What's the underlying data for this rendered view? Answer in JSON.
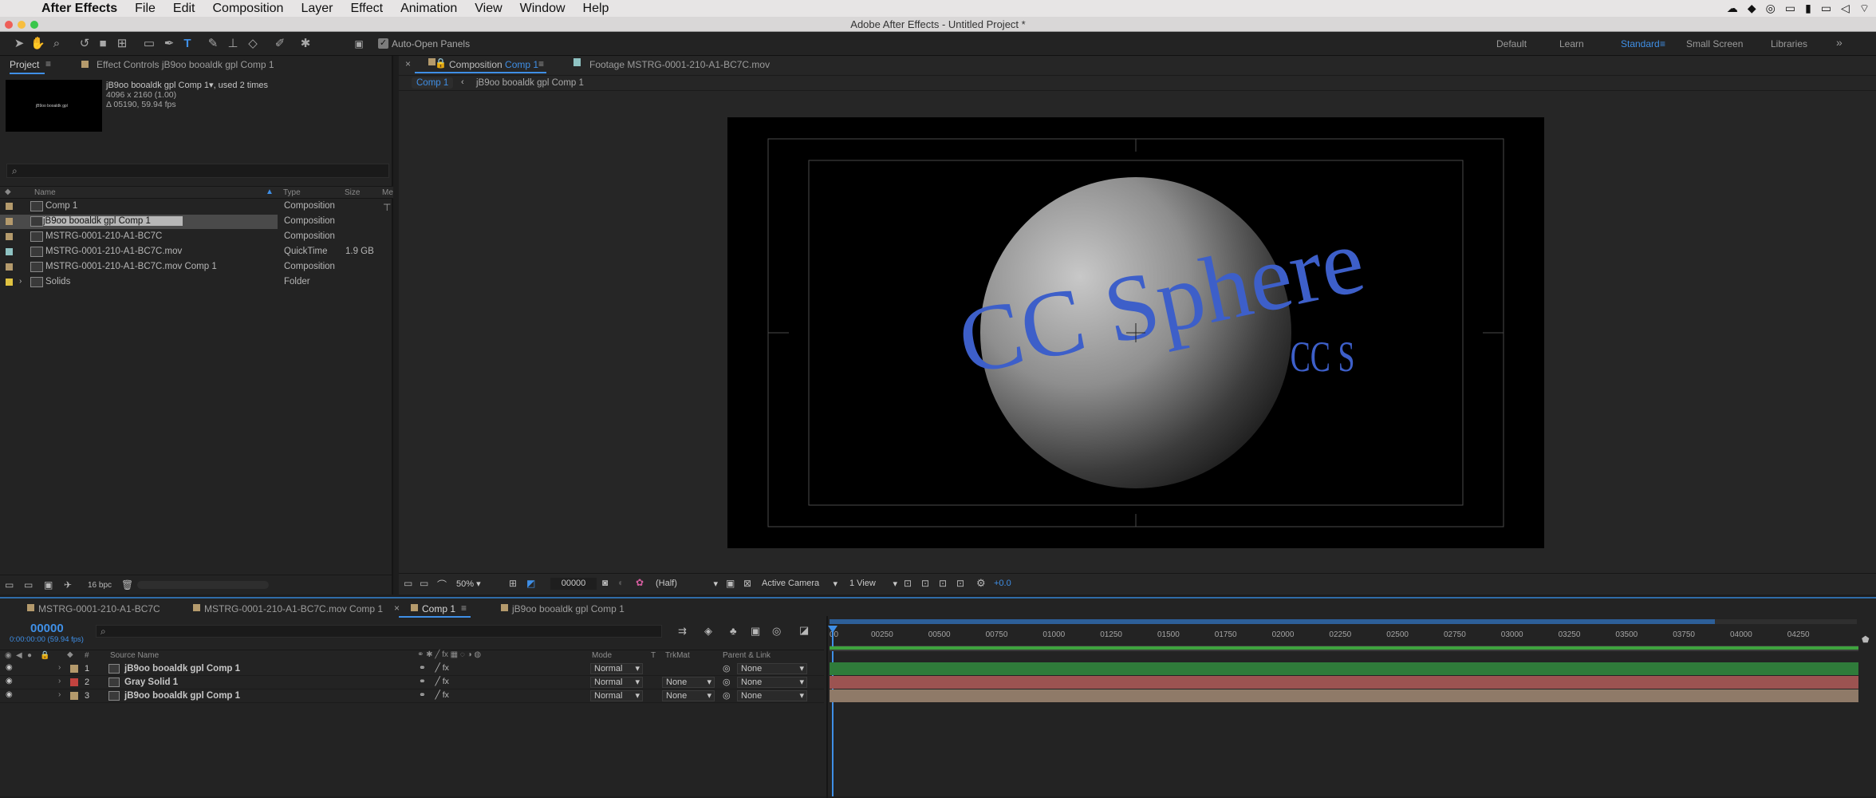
{
  "menubar": {
    "app": "After Effects",
    "items": [
      "File",
      "Edit",
      "Composition",
      "Layer",
      "Effect",
      "Animation",
      "View",
      "Window",
      "Help"
    ]
  },
  "window": {
    "title": "Adobe After Effects - Untitled Project *"
  },
  "toolbar": {
    "auto_open_label": "Auto-Open Panels",
    "workspaces": [
      "Default",
      "Learn",
      "Standard",
      "Small Screen",
      "Libraries"
    ],
    "active_workspace": "Standard"
  },
  "project": {
    "tab_project": "Project",
    "tab_effects": "Effect Controls jB9oo booaldk gpl  Comp 1",
    "selected_name": "jB9oo booaldk gpl  Comp 1",
    "used_times": ", used 2 times",
    "selected_dims": "4096 x 2160 (1.00)",
    "selected_dur": "Δ 05190, 59.94 fps",
    "thumb_text": "jB9oo booaldk gpl",
    "search_placeholder": "",
    "columns": {
      "name": "Name",
      "type": "Type",
      "size": "Size",
      "media": "Me"
    },
    "items": [
      {
        "name": "Comp 1",
        "type": "Composition",
        "size": "",
        "color": "#b49a6c"
      },
      {
        "name": "jB9oo booaldk gpl  Comp 1",
        "type": "Composition",
        "size": "",
        "color": "#b49a6c"
      },
      {
        "name": "MSTRG-0001-210-A1-BC7C",
        "type": "Composition",
        "size": "",
        "color": "#b49a6c"
      },
      {
        "name": "MSTRG-0001-210-A1-BC7C.mov",
        "type": "QuickTime",
        "size": "1.9 GB",
        "color": "#8fc3c3"
      },
      {
        "name": "MSTRG-0001-210-A1-BC7C.mov Comp 1",
        "type": "Composition",
        "size": "",
        "color": "#b49a6c"
      },
      {
        "name": "Solids",
        "type": "Folder",
        "size": "",
        "color": "#e0c341"
      }
    ],
    "bpc": "16 bpc"
  },
  "viewer": {
    "tab_comp_prefix": "Composition ",
    "tab_comp_name": "Comp 1",
    "tab_footage": "Footage MSTRG-0001-210-A1-BC7C.mov",
    "crumb_active": "Comp 1",
    "crumb_next": "jB9oo booaldk gpl  Comp 1",
    "text_main": "CC Sphere",
    "text_side": "CC S",
    "zoom": "50%",
    "timecode": "00000",
    "resolution": "(Half)",
    "camera": "Active Camera",
    "views": "1 View",
    "exposure": "+0.0"
  },
  "timeline": {
    "tabs": [
      "MSTRG-0001-210-A1-BC7C",
      "MSTRG-0001-210-A1-BC7C.mov Comp 1",
      "Comp 1",
      "jB9oo booaldk gpl  Comp 1"
    ],
    "active_tab": "Comp 1",
    "timecode": "00000",
    "timecode_sub": "0:00:00:00 (59.94 fps)",
    "columns": {
      "num": "#",
      "source": "Source Name",
      "mode": "Mode",
      "t": "T",
      "trkmat": "TrkMat",
      "parent": "Parent & Link"
    },
    "layers": [
      {
        "num": "1",
        "name": "jB9oo booaldk gpl  Comp 1",
        "color": "#b49a6c",
        "mode": "Normal",
        "trkmat": "",
        "parent": "None",
        "bar": "#2f7b3a"
      },
      {
        "num": "2",
        "name": "Gray Solid 1",
        "color": "#c2433f",
        "mode": "Normal",
        "trkmat": "None",
        "parent": "None",
        "bar": "#9c5351"
      },
      {
        "num": "3",
        "name": "jB9oo booaldk gpl  Comp 1",
        "color": "#b49a6c",
        "mode": "Normal",
        "trkmat": "None",
        "parent": "None",
        "bar": "#8f7a68"
      }
    ],
    "ruler": [
      "00250",
      "00500",
      "00750",
      "01000",
      "01250",
      "01500",
      "01750",
      "02000",
      "02250",
      "02500",
      "02750",
      "03000",
      "03250",
      "03500",
      "03750",
      "04000",
      "04250"
    ]
  }
}
